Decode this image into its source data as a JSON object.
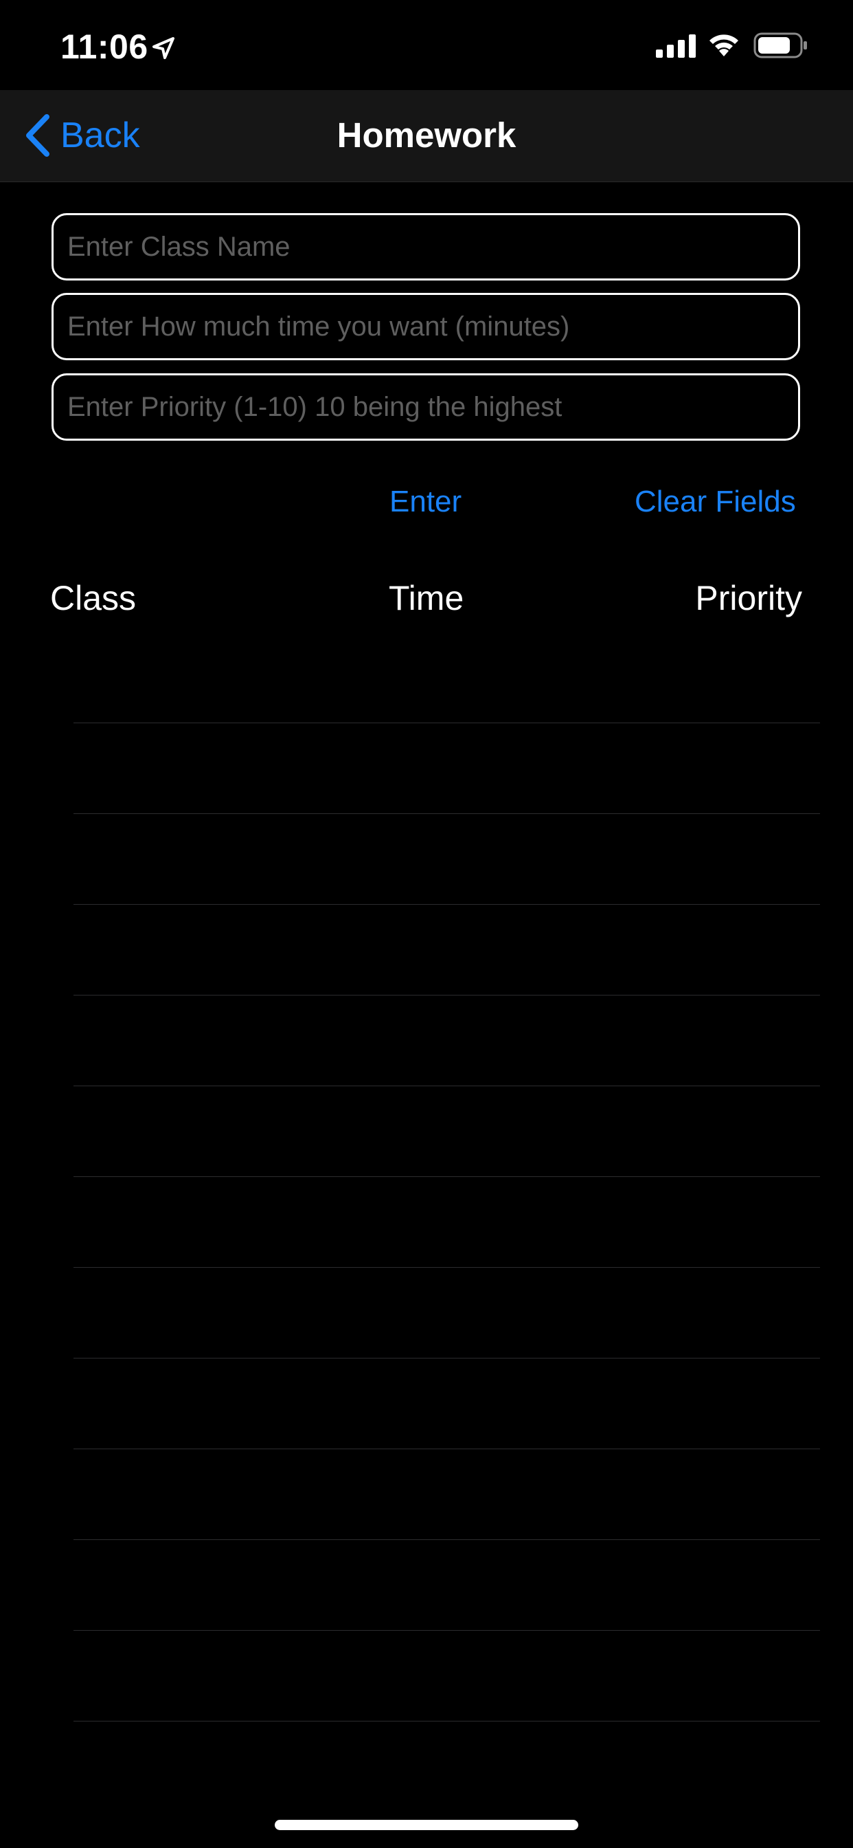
{
  "status_bar": {
    "time": "11:06"
  },
  "nav": {
    "back_label": "Back",
    "title": "Homework"
  },
  "form": {
    "class_placeholder": "Enter Class Name",
    "time_placeholder": "Enter How much time you want (minutes)",
    "priority_placeholder": "Enter Priority (1-10) 10 being the highest",
    "class_value": "",
    "time_value": "",
    "priority_value": ""
  },
  "actions": {
    "enter_label": "Enter",
    "clear_label": "Clear Fields"
  },
  "table": {
    "headers": {
      "class": "Class",
      "time": "Time",
      "priority": "Priority"
    },
    "rows": []
  },
  "icons": {
    "location": "location-arrow-icon",
    "signal": "cellular-signal-icon",
    "wifi": "wifi-icon",
    "battery": "battery-icon",
    "back": "chevron-left-icon"
  },
  "colors": {
    "accent": "#1a82f7",
    "background": "#000000",
    "nav_background": "#161616",
    "placeholder": "#5f5f5f",
    "separator": "#2c2c2e"
  }
}
